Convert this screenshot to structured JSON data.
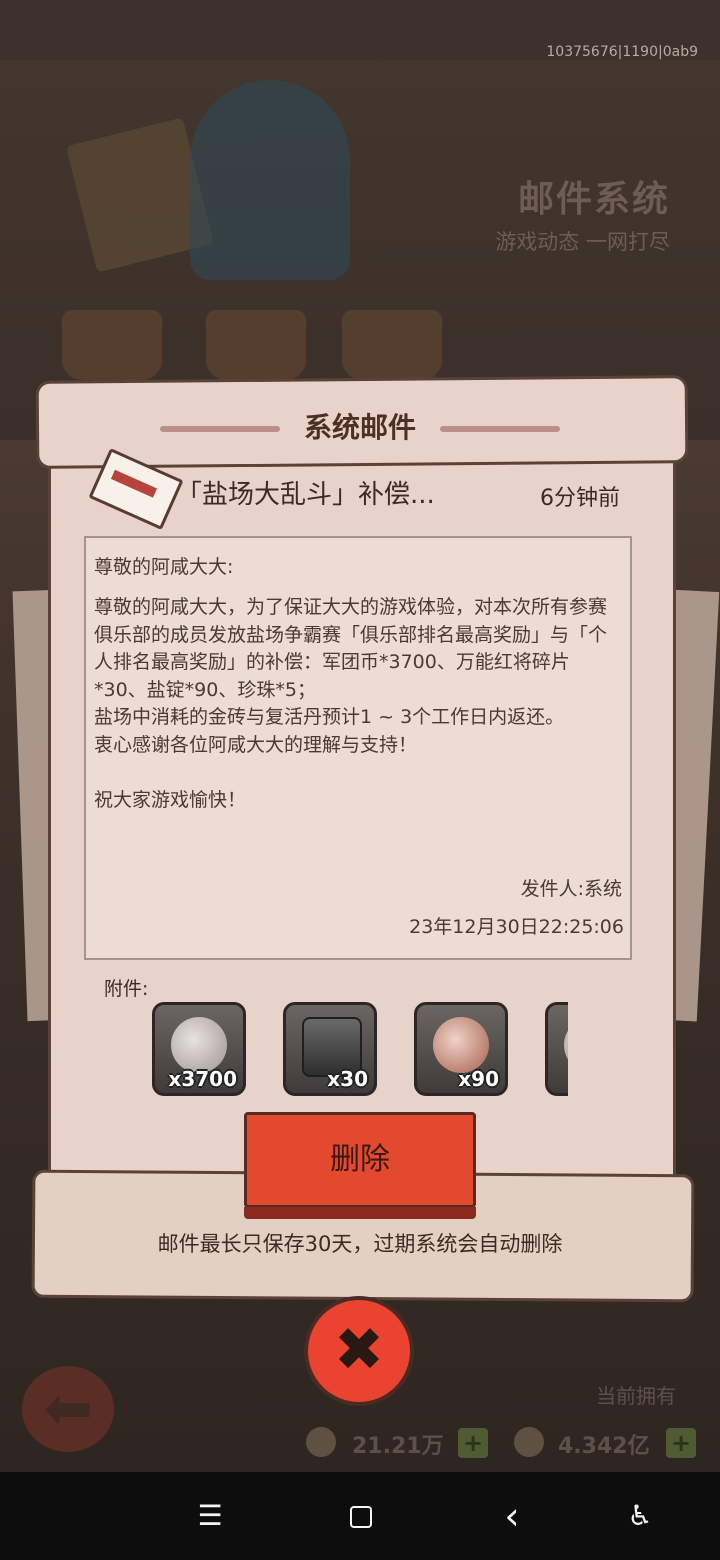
{
  "build_id": "10375676|1190|0ab9",
  "background": {
    "title": "邮件系统",
    "subtitle": "游戏动态 一网打尽",
    "owned_label": "当前拥有",
    "resource_1": "21.21万",
    "resource_2": "4.342亿"
  },
  "dialog": {
    "title": "系统邮件",
    "subject": "「盐场大乱斗」补偿...",
    "time_ago": "6分钟前",
    "greeting": "尊敬的阿咸大大:",
    "body": "尊敬的阿咸大大，为了保证大大的游戏体验，对本次所有参赛俱乐部的成员发放盐场争霸赛「俱乐部排名最高奖励」与「个人排名最高奖励」的补偿：军团币*3700、万能红将碎片*30、盐锭*90、珍珠*5；\n盐场中消耗的金砖与复活丹预计1 ~ 3个工作日内返还。\n衷心感谢各位阿咸大大的理解与支持！\n\n祝大家游戏愉快！",
    "sender": "发件人:系统",
    "date": "23年12月30日22:25:06",
    "attachments_label": "附件:",
    "attachments": [
      {
        "icon": "legion-coin-icon",
        "qty": "x3700",
        "color": "#c9c2bd"
      },
      {
        "icon": "chest-fragment-icon",
        "qty": "x30",
        "color": "#505050"
      },
      {
        "icon": "salt-ingot-icon",
        "qty": "x90",
        "color": "#d89a86"
      },
      {
        "icon": "pearl-icon",
        "qty": "",
        "color": "#bdb7b4"
      }
    ],
    "delete_label": "删除",
    "retention_note": "邮件最长只保存30天，过期系统会自动删除"
  },
  "navbar": {
    "menu": "☰",
    "home": "□",
    "back": "‹",
    "accessibility": "♿"
  }
}
